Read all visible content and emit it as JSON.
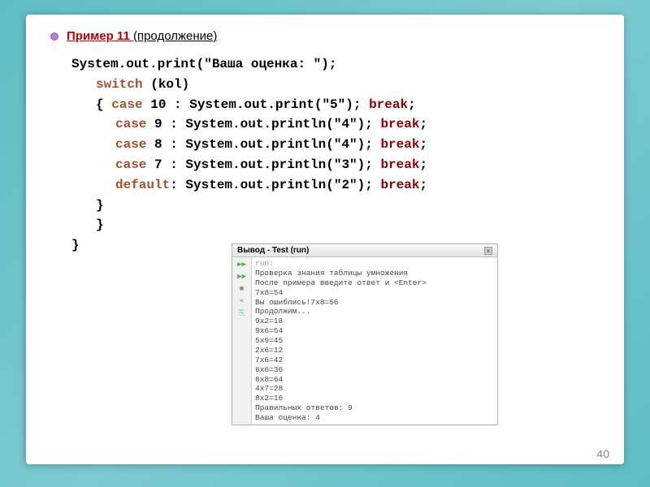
{
  "title": {
    "red": "Пример 11 ",
    "rest": "(продолжение)"
  },
  "code": {
    "l1_a": "System.out.print(\"",
    "l1_b": "Ваша оценка: ",
    "l1_c": "\");",
    "l2_kw": "switch",
    "l2_rest": " (kol)",
    "l3_a": "{ ",
    "l3_case": "case",
    "l3_b": " 10 : System.out.print(\"5\"); ",
    "l3_break": "break",
    "l3_c": ";",
    "l4_case": "case",
    "l4_b": " 9 : System.out.println(\"4\"); ",
    "l4_break": "break",
    "l4_c": ";",
    "l5_case": "case",
    "l5_b": " 8 : System.out.println(\"4\"); ",
    "l5_break": "break",
    "l5_c": ";",
    "l6_case": "case",
    "l6_b": " 7 : System.out.println(\"3\"); ",
    "l6_break": "break",
    "l6_c": ";",
    "l7_default": "default",
    "l7_b": ": System.out.println(\"2\"); ",
    "l7_break": "break",
    "l7_c": ";",
    "l8": "}",
    "l9": "}",
    "l10": "}"
  },
  "panel": {
    "title": "Вывод - Test (run)",
    "close": "×",
    "output": {
      "run": "run:",
      "lines": [
        "Проверка знания таблицы умножения",
        "После примера введите ответ и <Enter>",
        "7x8=54",
        "Вы ошиблись!7x8=56",
        "Продолжим...",
        "9x2=18",
        "9x6=54",
        "5x9=45",
        "2x6=12",
        "7x6=42",
        "6x6=36",
        "8x8=64",
        "4x7=28",
        "8x2=16",
        "Правильных ответов: 9",
        "Ваша оценка: 4"
      ]
    }
  },
  "page": "40"
}
